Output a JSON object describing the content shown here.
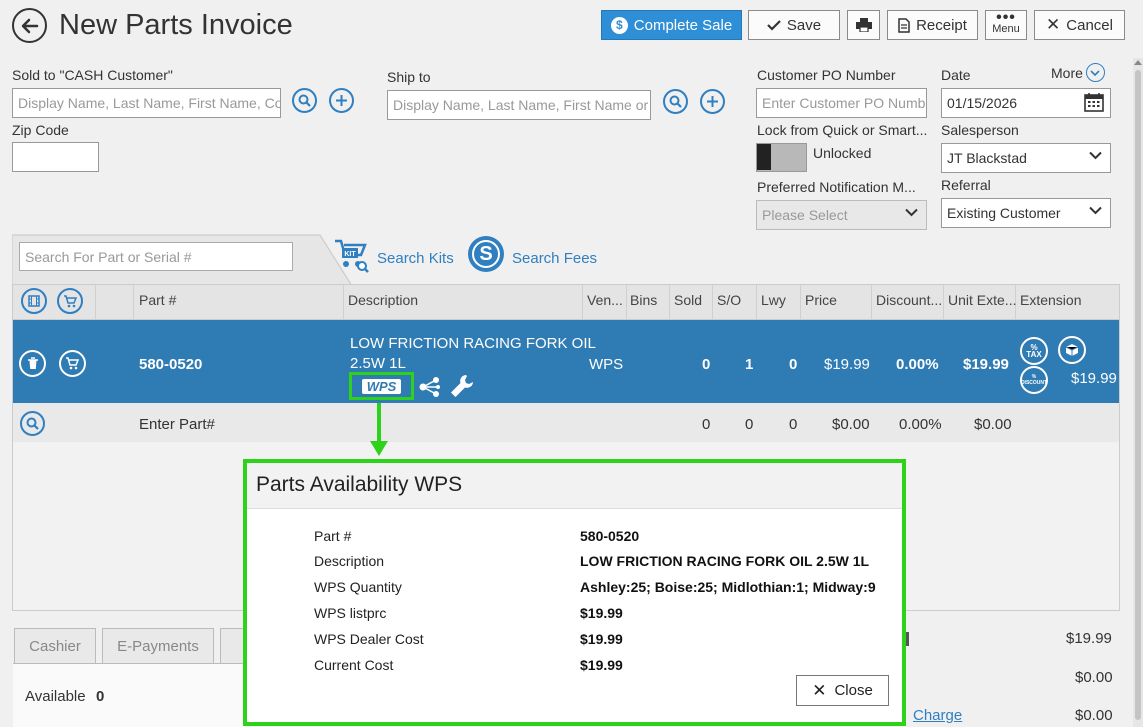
{
  "header": {
    "title": "New Parts Invoice",
    "complete_sale": "Complete Sale",
    "save": "Save",
    "receipt": "Receipt",
    "menu": "Menu",
    "cancel": "Cancel"
  },
  "sold_to": {
    "label": "Sold to  \"CASH Customer\"",
    "placeholder": "Display Name, Last Name, First Name, Co"
  },
  "ship_to": {
    "label": "Ship to",
    "placeholder": "Display Name, Last Name, First Name or"
  },
  "zip": {
    "label": "Zip Code",
    "value": ""
  },
  "customer_po": {
    "label": "Customer PO Number",
    "placeholder": "Enter Customer PO Numb"
  },
  "date": {
    "label": "Date",
    "value": "01/15/2026",
    "more": "More"
  },
  "lock": {
    "label": "Lock from Quick or Smart...",
    "status": "Unlocked"
  },
  "salesperson": {
    "label": "Salesperson",
    "value": "JT Blackstad"
  },
  "notification": {
    "label": "Preferred Notification M...",
    "value": "Please Select"
  },
  "referral": {
    "label": "Referral",
    "value": "Existing Customer"
  },
  "search": {
    "placeholder": "Search For Part or Serial #",
    "kits": "Search Kits",
    "fees": "Search Fees"
  },
  "table": {
    "columns": [
      "Part #",
      "Description",
      "Ven...",
      "Bins",
      "Sold",
      "S/O",
      "Lwy",
      "Price",
      "Discount...",
      "Unit Exte...",
      "Extension"
    ],
    "row": {
      "part": "580-0520",
      "desc_line1": "LOW FRICTION RACING FORK OIL",
      "desc_line2": "2.5W 1L",
      "vendor": "WPS",
      "vendor_logo": "WPS",
      "sold": "0",
      "so": "1",
      "lwy": "0",
      "price": "$19.99",
      "discount": "0.00%",
      "unit_ext": "$19.99",
      "extension": "$19.99",
      "tax_badge": "%\nTAX",
      "discount_badge": "%\nDISCOUNT"
    },
    "entry_row": {
      "placeholder": "Enter Part#",
      "sold": "0",
      "so": "0",
      "lwy": "0",
      "price": "$0.00",
      "discount": "0.00%",
      "unit_ext": "$0.00"
    }
  },
  "bottom": {
    "tabs": [
      "Cashier",
      "E-Payments"
    ],
    "available_label": "Available",
    "available_value": "0",
    "total1": "$19.99",
    "total2": "$0.00",
    "total3": "$0.00",
    "charge_link": "Charge"
  },
  "modal": {
    "title": "Parts Availability WPS",
    "rows": [
      {
        "label": "Part #",
        "value": "580-0520"
      },
      {
        "label": "Description",
        "value": "LOW FRICTION RACING FORK OIL 2.5W 1L"
      },
      {
        "label": "WPS Quantity",
        "value": "Ashley:25; Boise:25; Midlothian:1; Midway:9"
      },
      {
        "label": "WPS listprc",
        "value": "$19.99"
      },
      {
        "label": "WPS Dealer Cost",
        "value": "$19.99"
      },
      {
        "label": "Current Cost",
        "value": "$19.99"
      }
    ],
    "close": "Close"
  },
  "colors": {
    "accent": "#2f7fc1",
    "selected_row": "#2f7bb3",
    "highlight_green": "#2fd21a"
  }
}
